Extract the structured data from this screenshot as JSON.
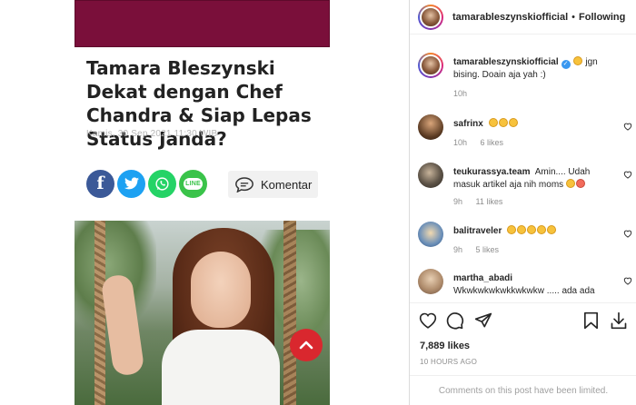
{
  "article": {
    "title": "Tamara Bleszynski Dekat dengan Chef Chandra & Siap Lepas Status Janda?",
    "date": "Kamis, 30 Sep 2021 11:30 WIB",
    "share": {
      "facebook_glyph": "f",
      "line_label": "LINE"
    },
    "comment_button_label": "Komentar",
    "colors": {
      "banner": "#7a0f3a",
      "scroll_top": "#d9272e",
      "facebook": "#3b5998",
      "twitter": "#1da1f2",
      "whatsapp": "#25d366"
    }
  },
  "instagram": {
    "header": {
      "username": "tamarableszynskiofficial",
      "follow_state": "Following",
      "separator": "•"
    },
    "comments": [
      {
        "username": "tamarableszynskiofficial",
        "verified": true,
        "emojis": 1,
        "text": "jgn bising. Doain aja yah :)",
        "time": "10h",
        "likes": ""
      },
      {
        "username": "safrinx",
        "emojis": 3,
        "text": "",
        "time": "10h",
        "likes": "6 likes"
      },
      {
        "username": "teukurassya.team",
        "text": "Amin.... Udah masuk artikel aja nih moms",
        "trailing_emojis": 2,
        "time": "9h",
        "likes": "11 likes"
      },
      {
        "username": "balitraveler",
        "emojis": 5,
        "text": "",
        "time": "9h",
        "likes": "5 likes"
      },
      {
        "username": "martha_abadi",
        "text": "Wkwkwkwkwkkwkwkw ..... ada ada",
        "time": "",
        "likes": ""
      }
    ],
    "likes_count": "7,889 likes",
    "posted_ago": "10 HOURS AGO",
    "comments_limited": "Comments on this post have been limited."
  }
}
